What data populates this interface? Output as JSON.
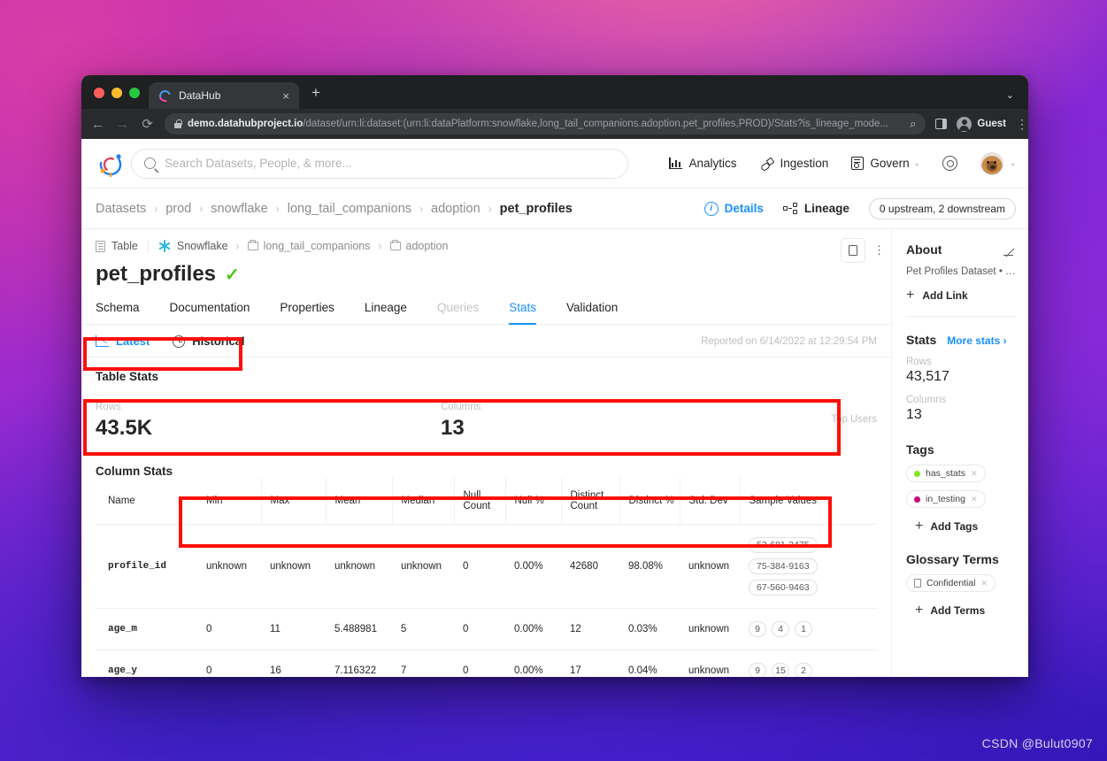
{
  "browser": {
    "tab_title": "DataHub",
    "tab_close": "×",
    "new_tab": "+",
    "window_chevron": "⌄",
    "back": "←",
    "forward": "→",
    "reload": "⟳",
    "url_domain": "demo.datahubproject.io",
    "url_path": "/dataset/urn:li:dataset:(urn:li:dataPlatform:snowflake,long_tail_companions.adoption.pet_profiles,PROD)/Stats?is_lineage_mode...",
    "zoom_icon": "⌕",
    "profile_label": "Guest",
    "menu": "⋮"
  },
  "topnav": {
    "search_placeholder": "Search Datasets, People, & more...",
    "items": [
      {
        "label": "Analytics"
      },
      {
        "label": "Ingestion"
      },
      {
        "label": "Govern",
        "chevron": "⌄"
      }
    ],
    "avatar_chevron": "⌄"
  },
  "breadcrumb": {
    "items": [
      "Datasets",
      "prod",
      "snowflake",
      "long_tail_companions",
      "adoption",
      "pet_profiles"
    ],
    "separator": "›",
    "details_label": "Details",
    "lineage_label": "Lineage",
    "lineage_badge": "0 upstream, 2 downstream"
  },
  "entity": {
    "type_label": "Table",
    "platform": "Snowflake",
    "path": [
      "long_tail_companions",
      "adoption"
    ],
    "separator": "›",
    "title": "pet_profiles",
    "verified_check": "✓",
    "kebab": "⋮"
  },
  "tabs": [
    {
      "label": "Schema",
      "state": "normal"
    },
    {
      "label": "Documentation",
      "state": "normal"
    },
    {
      "label": "Properties",
      "state": "normal"
    },
    {
      "label": "Lineage",
      "state": "normal"
    },
    {
      "label": "Queries",
      "state": "disabled"
    },
    {
      "label": "Stats",
      "state": "active"
    },
    {
      "label": "Validation",
      "state": "normal"
    }
  ],
  "stats_toggle": {
    "latest_label": "Latest",
    "historical_label": "Historical",
    "reported": "Reported on 6/14/2022 at 12:29:54 PM"
  },
  "table_stats": {
    "section_title": "Table Stats",
    "rows_label": "Rows",
    "rows_value": "43.5K",
    "columns_label": "Columns",
    "columns_value": "13",
    "top_users_label": "Top Users"
  },
  "column_stats": {
    "section_title": "Column Stats",
    "headers": [
      "Name",
      "Min",
      "Max",
      "Mean",
      "Median",
      "Null Count",
      "Null %",
      "Distinct Count",
      "Distinct %",
      "Std. Dev",
      "Sample Values"
    ],
    "rows": [
      {
        "name": "profile_id",
        "min": "unknown",
        "max": "unknown",
        "mean": "unknown",
        "median": "unknown",
        "null_count": "0",
        "null_pct": "0.00%",
        "distinct_count": "42680",
        "distinct_pct": "98.08%",
        "std_dev": "unknown",
        "samples": [
          "53-681-2475",
          "75-384-9163",
          "67-560-9463"
        ]
      },
      {
        "name": "age_m",
        "min": "0",
        "max": "11",
        "mean": "5.488981",
        "median": "5",
        "null_count": "0",
        "null_pct": "0.00%",
        "distinct_count": "12",
        "distinct_pct": "0.03%",
        "std_dev": "unknown",
        "samples": [
          "9",
          "4",
          "1"
        ]
      },
      {
        "name": "age_y",
        "min": "0",
        "max": "16",
        "mean": "7.116322",
        "median": "7",
        "null_count": "0",
        "null_pct": "0.00%",
        "distinct_count": "17",
        "distinct_pct": "0.04%",
        "std_dev": "unknown",
        "samples": [
          "9",
          "15",
          "2"
        ]
      }
    ]
  },
  "sidebar": {
    "about_title": "About",
    "about_desc": "Pet Profiles Dataset • …",
    "add_link": "Add Link",
    "stats_title": "Stats",
    "more_stats": "More stats ›",
    "rows_label": "Rows",
    "rows_value": "43,517",
    "columns_label": "Columns",
    "columns_value": "13",
    "tags_title": "Tags",
    "tags": [
      {
        "label": "has_stats",
        "color": "#7ee81f",
        "remove": "✕"
      },
      {
        "label": "in_testing",
        "color": "#c2007b",
        "remove": "✕"
      }
    ],
    "add_tags": "Add Tags",
    "glossary_title": "Glossary Terms",
    "terms": [
      {
        "label": "Confidential",
        "remove": "✕"
      }
    ],
    "add_terms": "Add Terms",
    "plus": "+"
  },
  "watermark": "CSDN @Bulut0907"
}
